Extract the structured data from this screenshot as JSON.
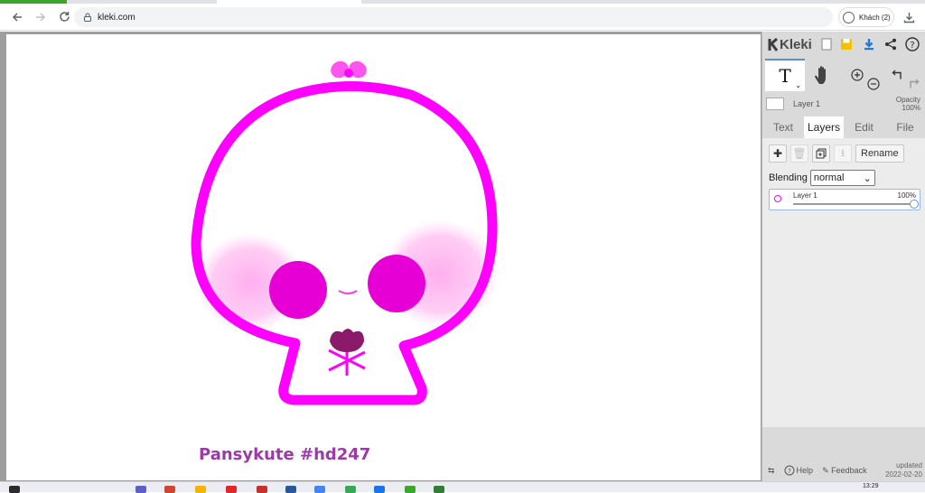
{
  "browser": {
    "url": "kleki.com",
    "profile_label": "Khách (2)"
  },
  "canvas": {
    "caption": "Pansykute #hd247",
    "colors": {
      "outline": "#ff00ff",
      "eyes": "#e600d6",
      "blush": "#ffb3f2",
      "flower": "#8b1a6b"
    }
  },
  "panel": {
    "logo": "Kleki",
    "layer_name": "Layer 1",
    "opacity_label": "Opacity",
    "opacity_value": "100%",
    "tabs": [
      "Text",
      "Layers",
      "Edit",
      "File"
    ],
    "active_tab": "Layers",
    "rename_label": "Rename",
    "blending_label": "Blending",
    "blending_value": "normal",
    "layer_item": {
      "name": "Layer 1",
      "opacity": "100%",
      "opacity_level": 1.0
    },
    "help_label": "Help",
    "feedback_label": "Feedback",
    "updated_label": "updated",
    "updated_date": "2022-02-20"
  },
  "taskbar": {
    "time": "13:29"
  }
}
